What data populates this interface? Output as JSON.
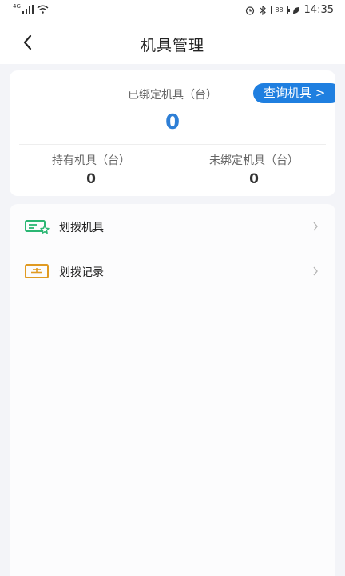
{
  "status_bar": {
    "network": "4G",
    "battery": "88",
    "time": "14:35",
    "icons": [
      "signal-icon",
      "wifi-icon",
      "alarm-icon",
      "bluetooth-icon",
      "battery-icon",
      "leaf-icon"
    ]
  },
  "header": {
    "title": "机具管理",
    "back_icon": "back-arrow-icon"
  },
  "summary": {
    "bound_label": "已绑定机具（台）",
    "bound_value": "0",
    "query_button": "查询机具 >",
    "held_label": "持有机具（台）",
    "held_value": "0",
    "unbound_label": "未绑定机具（台）",
    "unbound_value": "0"
  },
  "menu": {
    "items": [
      {
        "label": "划拨机具",
        "icon": "transfer-device-icon",
        "icon_color": "#2bb673"
      },
      {
        "label": "划拨记录",
        "icon": "transfer-record-icon",
        "icon_color": "#e09a22"
      }
    ]
  },
  "colors": {
    "accent": "#1f7fe0",
    "value_blue": "#2e7fd6",
    "background": "#f3f4f8"
  }
}
